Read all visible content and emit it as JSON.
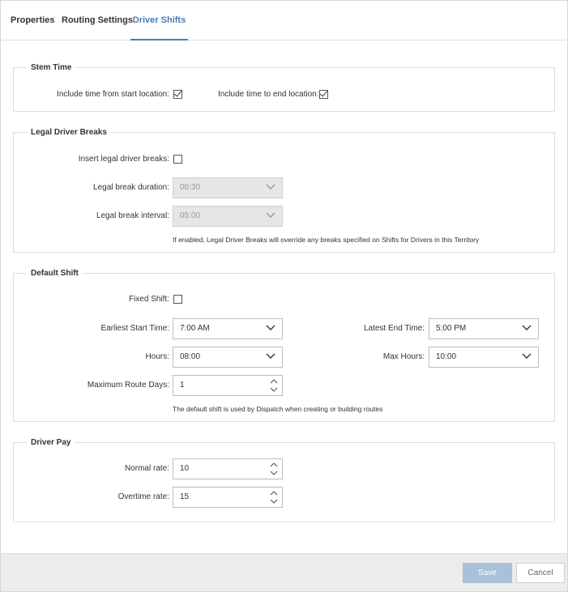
{
  "tabs": [
    {
      "label": "Properties"
    },
    {
      "label": "Routing Settings"
    },
    {
      "label": "Driver Shifts"
    }
  ],
  "stem_time": {
    "legend": "Stem Time",
    "start_label": "Include time from start location:",
    "start_checked": true,
    "end_label": "Include time to end location:",
    "end_checked": true
  },
  "legal_breaks": {
    "legend": "Legal Driver Breaks",
    "insert_label": "Insert legal driver breaks:",
    "insert_checked": false,
    "duration_label": "Legal break duration:",
    "duration_value": "00:30",
    "interval_label": "Legal break interval:",
    "interval_value": "05:00",
    "note": "If enabled, Legal Driver Breaks will override any breaks specified on Shifts for Drivers in this Territory"
  },
  "default_shift": {
    "legend": "Default Shift",
    "fixed_label": "Fixed Shift:",
    "fixed_checked": false,
    "earliest_label": "Earliest Start Time:",
    "earliest_value": "7:00 AM",
    "latest_label": "Latest End Time:",
    "latest_value": "5:00 PM",
    "hours_label": "Hours:",
    "hours_value": "08:00",
    "max_hours_label": "Max Hours:",
    "max_hours_value": "10:00",
    "route_days_label": "Maximum Route Days:",
    "route_days_value": "1",
    "note": "The default shift is used by Dispatch when creating or building routes"
  },
  "driver_pay": {
    "legend": "Driver Pay",
    "normal_label": "Normal rate:",
    "normal_value": "10",
    "overtime_label": "Overtime rate:",
    "overtime_value": "15"
  },
  "footer": {
    "save_label": "Save",
    "cancel_label": "Cancel"
  },
  "colors": {
    "accent": "#4b7bb8",
    "save_button": "#a9c0db",
    "footer_bg": "#ececec",
    "disabled_bg": "#e6e6e6"
  }
}
